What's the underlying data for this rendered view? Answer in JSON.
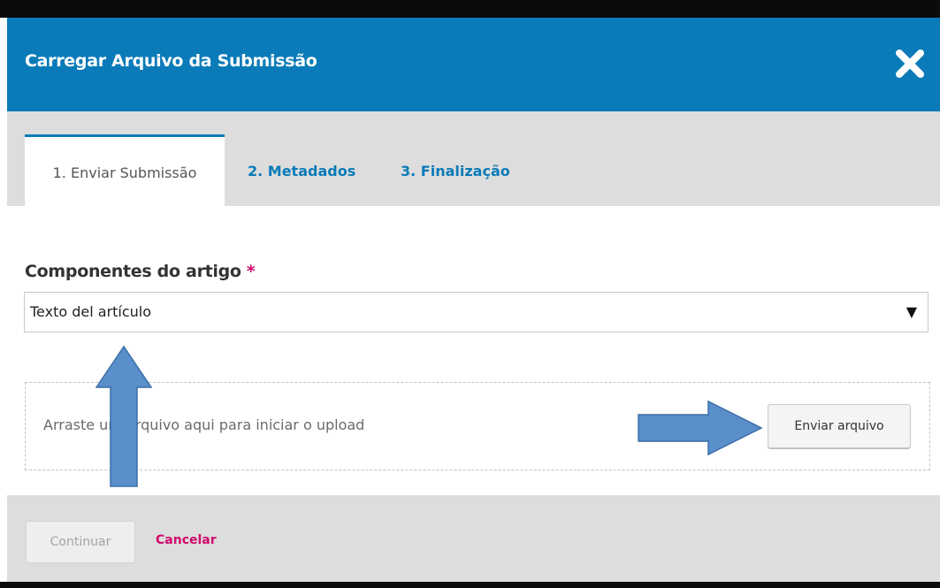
{
  "dialog": {
    "title": "Carregar Arquivo da Submissão",
    "close_icon": "close-icon"
  },
  "tabs": [
    {
      "label": "1. Enviar Submissão",
      "active": true
    },
    {
      "label": "2. Metadados",
      "active": false
    },
    {
      "label": "3. Finalização",
      "active": false
    }
  ],
  "form": {
    "components_label": "Componentes do artigo",
    "required_marker": "*",
    "components_selected": "Texto del artículo",
    "dropdown_icon": "triangle-down-icon"
  },
  "upload": {
    "dropzone_text": "Arraste um arquivo aqui para iniciar o upload",
    "button_label": "Enviar arquivo"
  },
  "footer": {
    "continue_label": "Continuar",
    "continue_enabled": false,
    "cancel_label": "Cancelar"
  },
  "colors": {
    "header_bg": "#0a7bb8",
    "tab_link": "#0a7bb8",
    "required": "#d00a6c",
    "cancel_link": "#d00a6c",
    "tabs_bg": "#dddddd",
    "annotation_arrow": "#5b8fcc"
  }
}
